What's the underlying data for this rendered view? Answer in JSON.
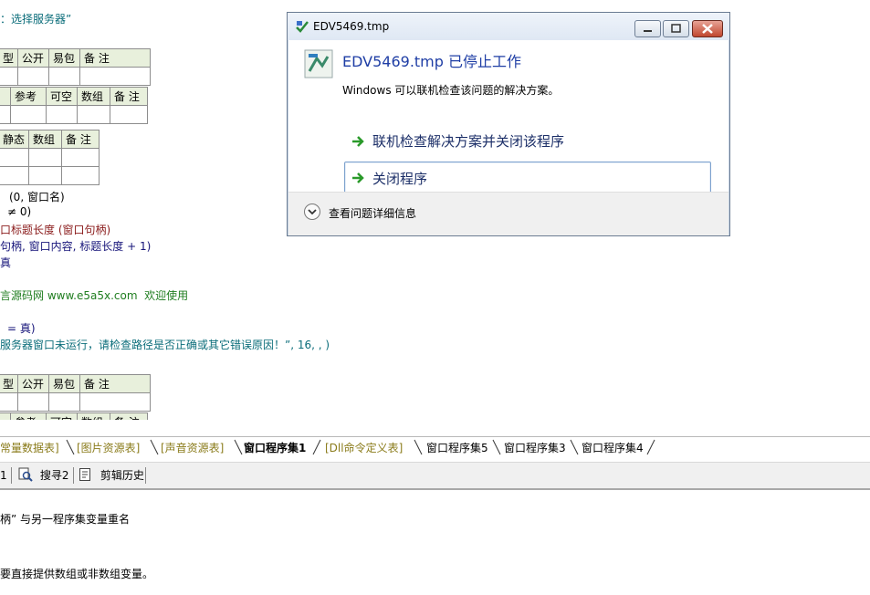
{
  "code": {
    "line1": "：选择服务器”",
    "t1_header": [
      "型",
      "公开",
      "易包",
      "备 注"
    ],
    "t1_sub": [
      "",
      "参考",
      "可空",
      "数组",
      "备 注"
    ],
    "t2_header": [
      "静态",
      "数组",
      "备 注"
    ],
    "line_a": "(0, 窗口名)",
    "line_b": "≠ 0)",
    "line_c": "口标题长度 (窗口句柄)",
    "line_d": "句柄, 窗口内容, 标题长度 + 1)",
    "line_e": "真",
    "line_f": "言源码网 www.e5a5x.com  欢迎使用",
    "line_g": "= 真)",
    "line_h": "服务器窗口未运行，请检查路径是否正确或其它错误原因！”, 16, , )",
    "t3_header": [
      "型",
      "公开",
      "易包",
      "备 注"
    ],
    "t3_sub_partial": [
      "",
      "参考",
      "可空",
      "数组",
      "备 注"
    ]
  },
  "tabs": [
    {
      "label": "常量数据表]",
      "style": "olive"
    },
    {
      "label": "[图片资源表]",
      "style": "olive"
    },
    {
      "label": "[声音资源表]",
      "style": "olive"
    },
    {
      "label": "窗口程序集1",
      "style": "active"
    },
    {
      "label": "[Dll命令定义表]",
      "style": "olive"
    },
    {
      "label": "窗口程序集5",
      "style": "plain"
    },
    {
      "label": "窗口程序集3",
      "style": "plain"
    },
    {
      "label": "窗口程序集4",
      "style": "plain"
    }
  ],
  "toolbar": {
    "item0": "1",
    "search2": "搜寻2",
    "clip_history": "剪辑历史"
  },
  "output": {
    "line1": "柄” 与另一程序集变量重名",
    "line2": "要直接提供数组或非数组变量。"
  },
  "dialog": {
    "title": "EDV5469.tmp",
    "heading": "EDV5469.tmp 已停止工作",
    "message": "Windows 可以联机检查该问题的解决方案。",
    "option1": "联机检查解决方案并关闭该程序",
    "option2": "关闭程序",
    "details": "查看问题详细信息"
  },
  "colors": {
    "heading": "#1f3ea5",
    "arrow": "#2a9a2a",
    "grid_header": "#e8f0dc"
  }
}
